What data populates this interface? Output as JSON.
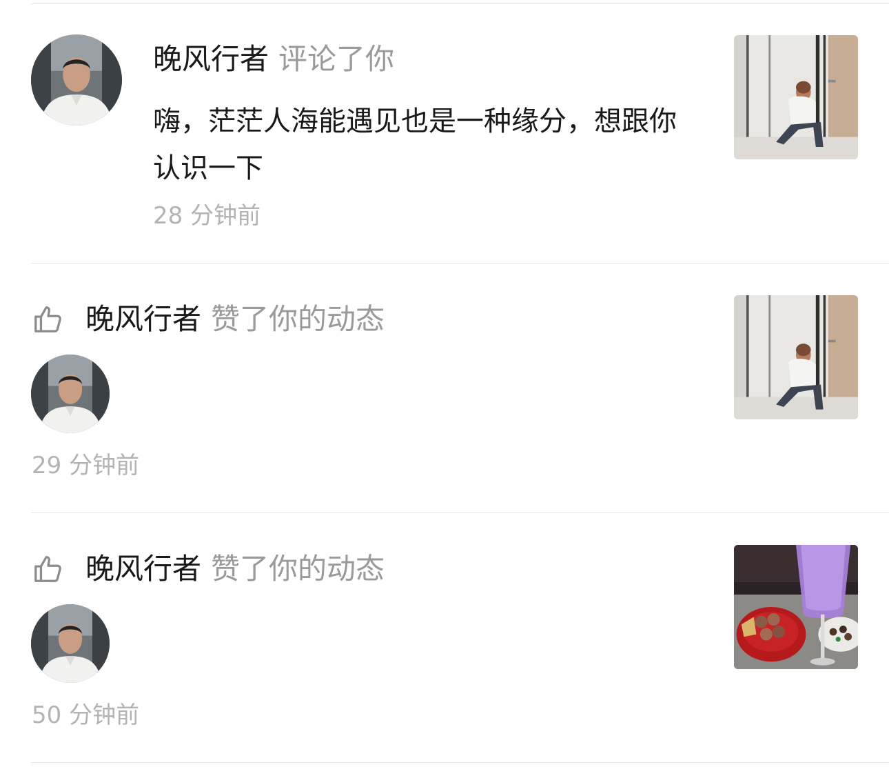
{
  "notifications": [
    {
      "type": "comment",
      "user": "晚风行者",
      "action": "评论了你",
      "comment": "嗨，茫茫人海能遇见也是一种缘分，想跟你认识一下",
      "time": "28 分钟前",
      "thumbnail": "photo-woman-sitting-mirror"
    },
    {
      "type": "like",
      "icon": "thumbs-up-icon",
      "user": "晚风行者",
      "action": "赞了你的动态",
      "time": "29 分钟前",
      "thumbnail": "photo-woman-sitting-mirror"
    },
    {
      "type": "like",
      "icon": "thumbs-up-icon",
      "user": "晚风行者",
      "action": "赞了你的动态",
      "time": "50 分钟前",
      "thumbnail": "photo-purple-drink-food"
    }
  ]
}
